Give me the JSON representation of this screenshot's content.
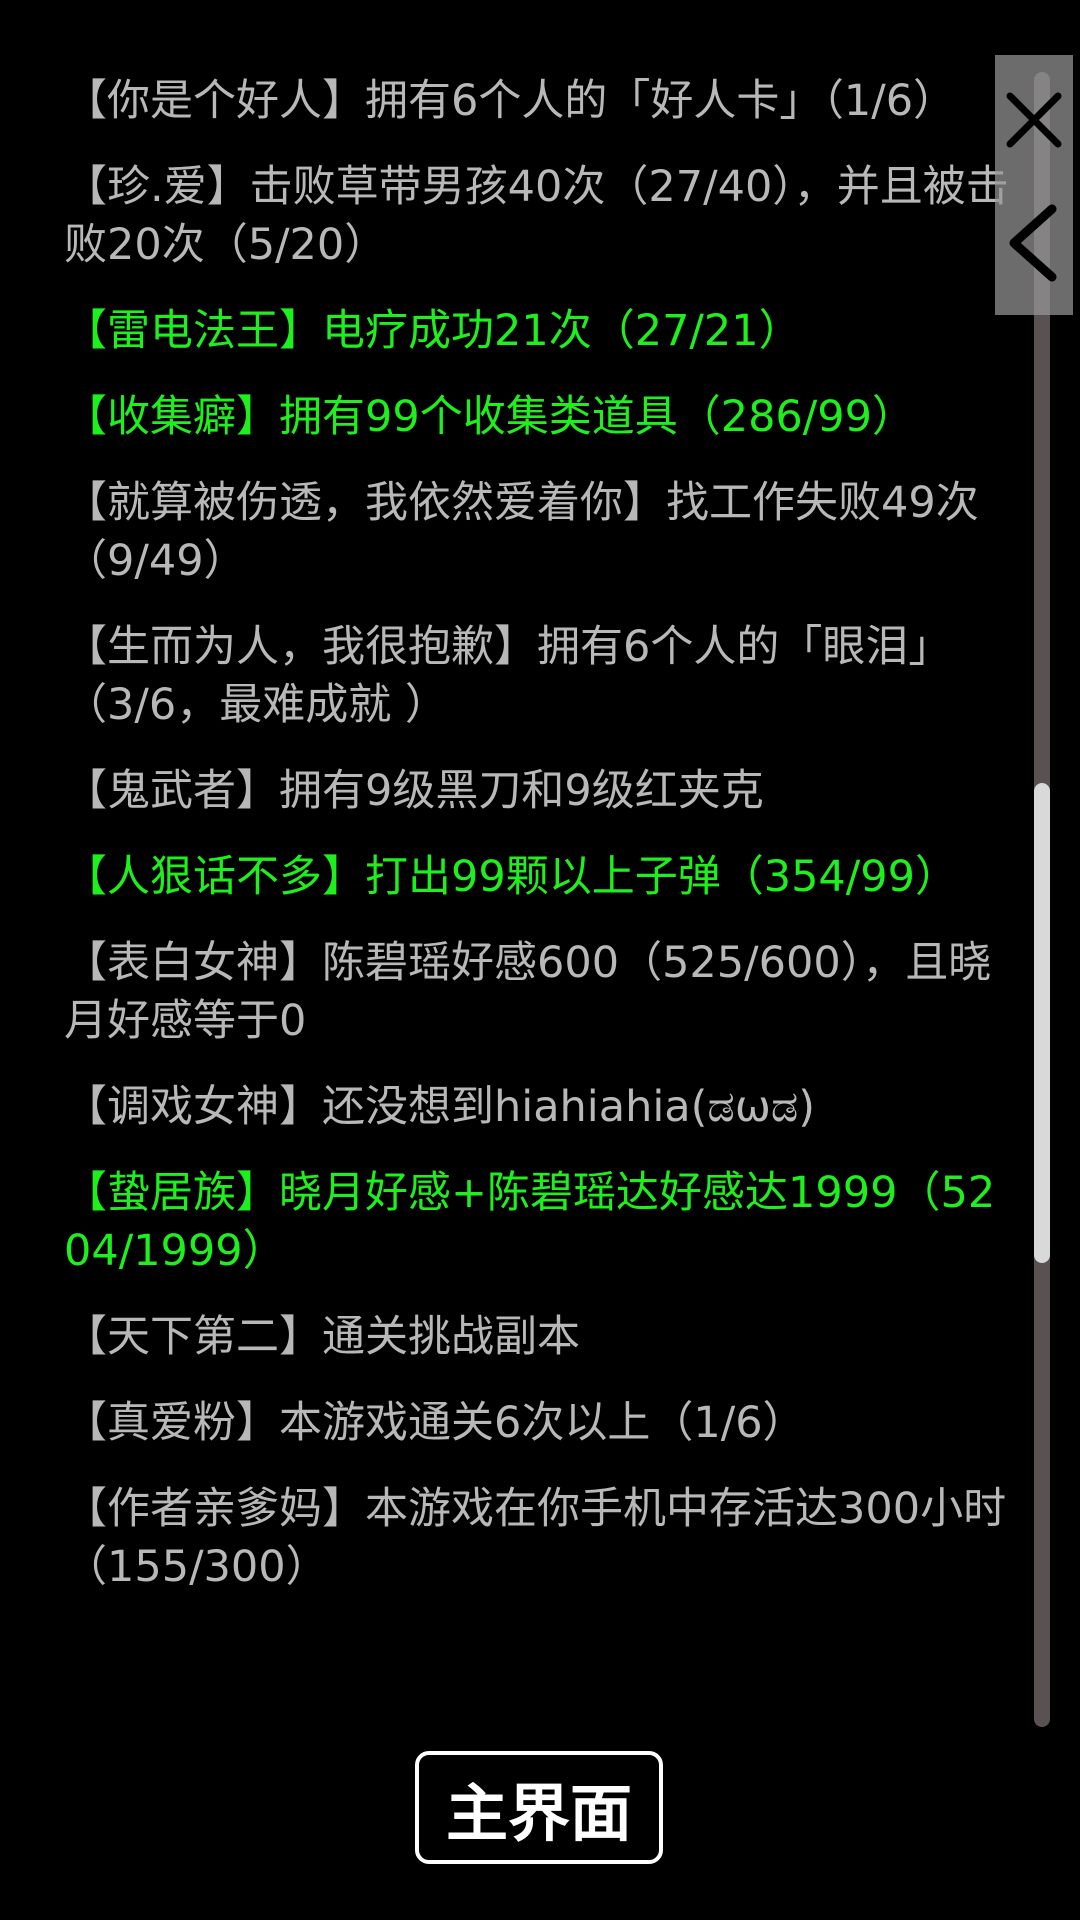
{
  "achievements": [
    {
      "text": "【你是个好人】拥有6个人的「好人卡」（1/6）",
      "completed": false
    },
    {
      "text": "【珍.爱】击败草带男孩40次（27/40），并且被击败20次（5/20）",
      "completed": false
    },
    {
      "text": "【雷电法王】电疗成功21次（27/21）",
      "completed": true
    },
    {
      "text": "【收集癖】拥有99个收集类道具（286/99）",
      "completed": true
    },
    {
      "text": "【就算被伤透，我依然爱着你】找工作失败49次（9/49）",
      "completed": false
    },
    {
      "text": "【生而为人，我很抱歉】拥有6个人的「眼泪」（3/6，最难成就 ）",
      "completed": false
    },
    {
      "text": "【鬼武者】拥有9级黑刀和9级红夹克",
      "completed": false
    },
    {
      "text": "【人狠话不多】打出99颗以上子弹（354/99）",
      "completed": true
    },
    {
      "text": "【表白女神】陈碧瑶好感600（525/600），且晓月好感等于0",
      "completed": false
    },
    {
      "text": "【调戏女神】还没想到hiahiahia(ಡωಡ)",
      "completed": false
    },
    {
      "text": "【蛰居族】晓月好感+陈碧瑶达好感达1999（5204/1999）",
      "completed": true
    },
    {
      "text": "【天下第二】通关挑战副本",
      "completed": false
    },
    {
      "text": "【真爱粉】本游戏通关6次以上（1/6）",
      "completed": false
    },
    {
      "text": "【作者亲爹妈】本游戏在你手机中存活达300小时（155/300）",
      "completed": false
    }
  ],
  "main_button_label": "主界面",
  "icons": {
    "close": "close-icon",
    "back": "chevron-left-icon"
  },
  "colors": {
    "completed": "#1ef01e",
    "incomplete": "#b8b8b8",
    "background": "#000000"
  }
}
